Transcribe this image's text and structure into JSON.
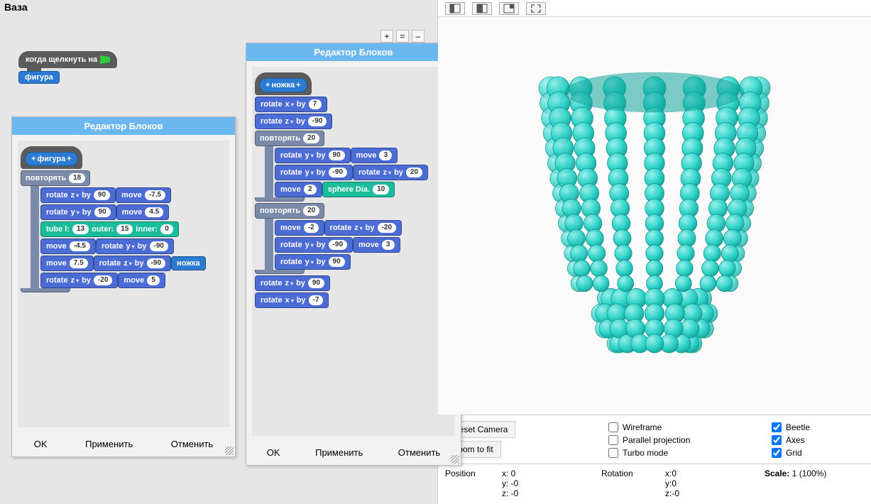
{
  "title": "Ваза",
  "zoom": {
    "plus": "+",
    "eq": "=",
    "minus": "–"
  },
  "hat": {
    "label": "когда щелкнуть на",
    "call": "фигура"
  },
  "dialog_title": "Редактор Блоков",
  "footer": {
    "ok": "OK",
    "apply": "Применить",
    "cancel": "Отменить"
  },
  "proc1": {
    "name": "фигура",
    "repeat_label": "повторять",
    "repeat_count": "18",
    "rows": [
      {
        "t": "rotate",
        "axis": "z",
        "by": "by",
        "val": "90"
      },
      {
        "t": "move",
        "val": "-7.5"
      },
      {
        "t": "rotate",
        "axis": "y",
        "by": "by",
        "val": "90"
      },
      {
        "t": "move",
        "val": "4.5"
      },
      {
        "t": "tube",
        "l_label": "tube l:",
        "l": "13",
        "outer_label": "outer:",
        "outer": "15",
        "inner_label": "inner:",
        "inner": "0"
      },
      {
        "t": "move",
        "val": "-4.5"
      },
      {
        "t": "rotate",
        "axis": "y",
        "by": "by",
        "val": "-90"
      },
      {
        "t": "move",
        "val": "7.5"
      },
      {
        "t": "rotate",
        "axis": "z",
        "by": "by",
        "val": "-90"
      },
      {
        "t": "call",
        "label": "ножка"
      },
      {
        "t": "rotate",
        "axis": "z",
        "by": "by",
        "val": "-20"
      },
      {
        "t": "move",
        "val": "5"
      }
    ]
  },
  "proc2": {
    "name": "ножка",
    "top": [
      {
        "t": "rotate",
        "axis": "x",
        "by": "by",
        "val": "7"
      },
      {
        "t": "rotate",
        "axis": "z",
        "by": "by",
        "val": "-90"
      }
    ],
    "repeat1_label": "повторять",
    "repeat1_count": "20",
    "loop1": [
      {
        "t": "rotate",
        "axis": "y",
        "by": "by",
        "val": "90"
      },
      {
        "t": "move",
        "val": "3"
      },
      {
        "t": "rotate",
        "axis": "y",
        "by": "by",
        "val": "-90"
      },
      {
        "t": "rotate",
        "axis": "z",
        "by": "by",
        "val": "20"
      },
      {
        "t": "move",
        "val": "2"
      },
      {
        "t": "sphere",
        "label": "sphere Dia.",
        "val": "10"
      }
    ],
    "repeat2_label": "повторять",
    "repeat2_count": "20",
    "loop2": [
      {
        "t": "move",
        "val": "-2"
      },
      {
        "t": "rotate",
        "axis": "z",
        "by": "by",
        "val": "-20"
      },
      {
        "t": "rotate",
        "axis": "y",
        "by": "by",
        "val": "-90"
      },
      {
        "t": "move",
        "val": "3"
      },
      {
        "t": "rotate",
        "axis": "y",
        "by": "by",
        "val": "90"
      }
    ],
    "bottom": [
      {
        "t": "rotate",
        "axis": "z",
        "by": "by",
        "val": "90"
      },
      {
        "t": "rotate",
        "axis": "x",
        "by": "by",
        "val": "-7"
      }
    ]
  },
  "labels": {
    "rotate": "rotate",
    "move": "move"
  },
  "right": {
    "reset": "Reset Camera",
    "zoomfit": "Zoom to fit",
    "wireframe": "Wireframe",
    "parallel": "Parallel projection",
    "turbo": "Turbo mode",
    "beetle": "Beetle",
    "axes": "Axes",
    "grid": "Grid",
    "position": "Position",
    "rotation": "Rotation",
    "scale_label": "Scale:",
    "scale_val": "1 (100%)",
    "px": "x: 0",
    "py": "y: -0",
    "pz": "z: -0",
    "rx": "x:0",
    "ry": "y:0",
    "rz": "z:-0"
  },
  "checked": {
    "wireframe": false,
    "parallel": false,
    "turbo": false,
    "beetle": true,
    "axes": true,
    "grid": true
  }
}
